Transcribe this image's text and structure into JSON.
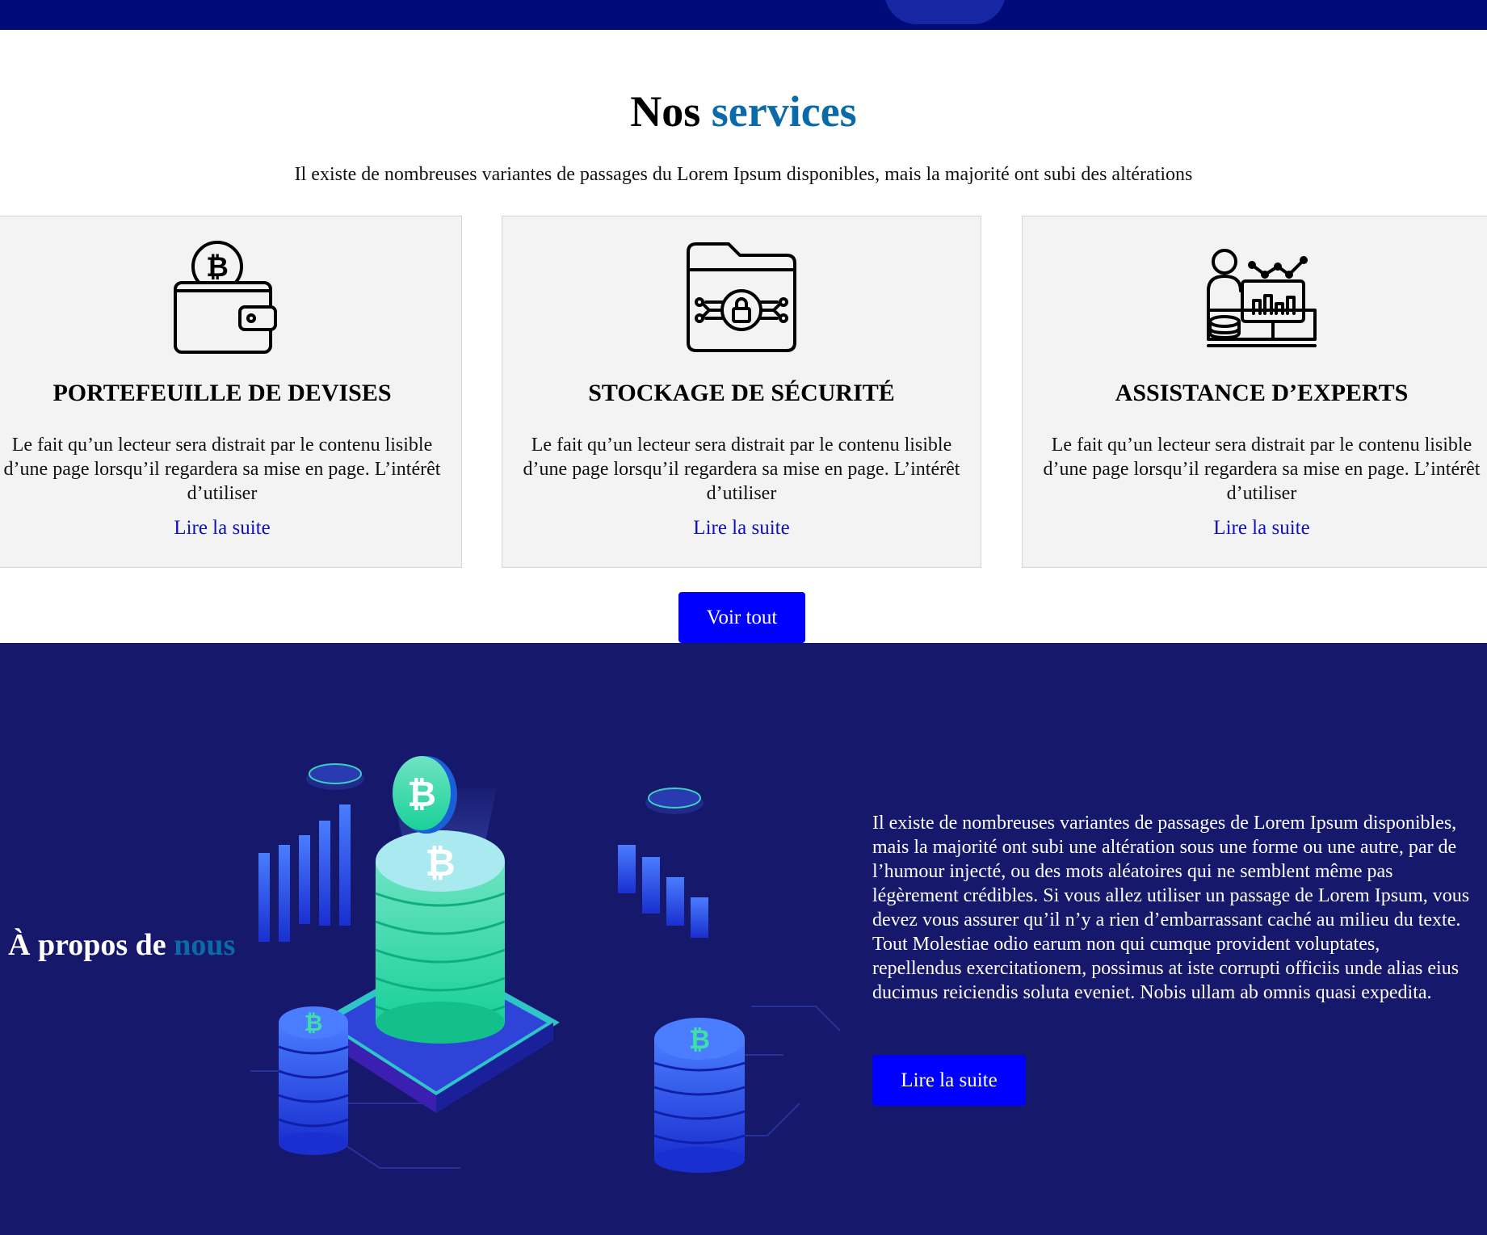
{
  "services": {
    "title_part1": "Nos",
    "title_part2": "services",
    "subtitle": "Il existe de nombreuses variantes de passages du Lorem Ipsum disponibles, mais la majorité ont subi des altérations",
    "cards": [
      {
        "icon": "wallet-bitcoin-icon",
        "title": "PORTEFEUILLE DE DEVISES",
        "text": "Le fait qu’un lecteur sera distrait par le contenu lisible d’une page lorsqu’il regardera sa mise en page. L’intérêt d’utiliser",
        "link": "Lire la suite"
      },
      {
        "icon": "secure-folder-lock-icon",
        "title": "STOCKAGE DE SÉCURITÉ",
        "text": "Le fait qu’un lecteur sera distrait par le contenu lisible d’une page lorsqu’il regardera sa mise en page. L’intérêt d’utiliser",
        "link": "Lire la suite"
      },
      {
        "icon": "expert-analytics-icon",
        "title": "ASSISTANCE D’EXPERTS",
        "text": "Le fait qu’un lecteur sera distrait par le contenu lisible d’une page lorsqu’il regardera sa mise en page. L’intérêt d’utiliser",
        "link": "Lire la suite"
      }
    ],
    "view_all": "Voir tout"
  },
  "about": {
    "title_part1": "À propos de",
    "title_part2": "nous",
    "text": "Il existe de nombreuses variantes de passages de Lorem Ipsum disponibles, mais la majorité ont subi une altération sous une forme ou une autre, par de l’humour injecté, ou des mots aléatoires qui ne semblent même pas légèrement crédibles. Si vous allez utiliser un passage de Lorem Ipsum, vous devez vous assurer qu’il n’y a rien d’embarrassant caché au milieu du texte. Tout Molestiae odio earum non qui cumque provident voluptates, repellendus exercitationem, possimus at iste corrupti officiis unde alias eius ducimus reiciendis soluta eveniet. Nobis ullam ab omnis quasi expedita.",
    "button": "Lire la suite",
    "illustration": "crypto-coins-illustration"
  },
  "colors": {
    "topbar": "#000b7a",
    "accent": "#0b6aa8",
    "button": "#0000ff",
    "about_bg": "#16186b",
    "link": "#1010c0"
  }
}
